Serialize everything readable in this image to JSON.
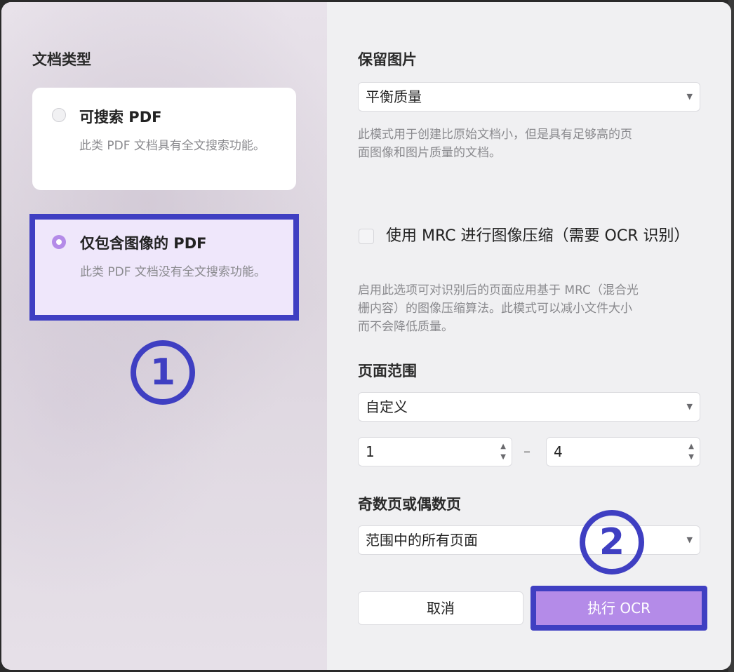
{
  "doc_type": {
    "heading": "文档类型",
    "options": [
      {
        "title": "可搜索 PDF",
        "desc": "此类 PDF 文档具有全文搜索功能。",
        "selected": false
      },
      {
        "title": "仅包含图像的 PDF",
        "desc": "此类 PDF 文档没有全文搜索功能。",
        "selected": true
      }
    ]
  },
  "annotations": {
    "marker1": "①",
    "marker2": "②"
  },
  "keep_images": {
    "heading": "保留图片",
    "value": "平衡质量",
    "desc_line1": "此模式用于创建比原始文档小，但是具有足够高的页",
    "desc_line2": "面图像和图片质量的文档。"
  },
  "mrc": {
    "checked": false,
    "label": "使用 MRC 进行图像压缩（需要 OCR 识别）",
    "desc_line1": "启用此选项可对识别后的页面应用基于 MRC（混合光",
    "desc_line2": "栅内容）的图像压缩算法。此模式可以减小文件大小",
    "desc_line3": "而不会降低质量。"
  },
  "page_range": {
    "heading": "页面范围",
    "value": "自定义",
    "from": "1",
    "separator": "–",
    "to": "4"
  },
  "odd_even": {
    "heading": "奇数页或偶数页",
    "value": "范围中的所有页面"
  },
  "buttons": {
    "cancel": "取消",
    "run": "执行 OCR"
  },
  "colors": {
    "accent": "#b48be8",
    "annotation": "#3f3fc2"
  }
}
